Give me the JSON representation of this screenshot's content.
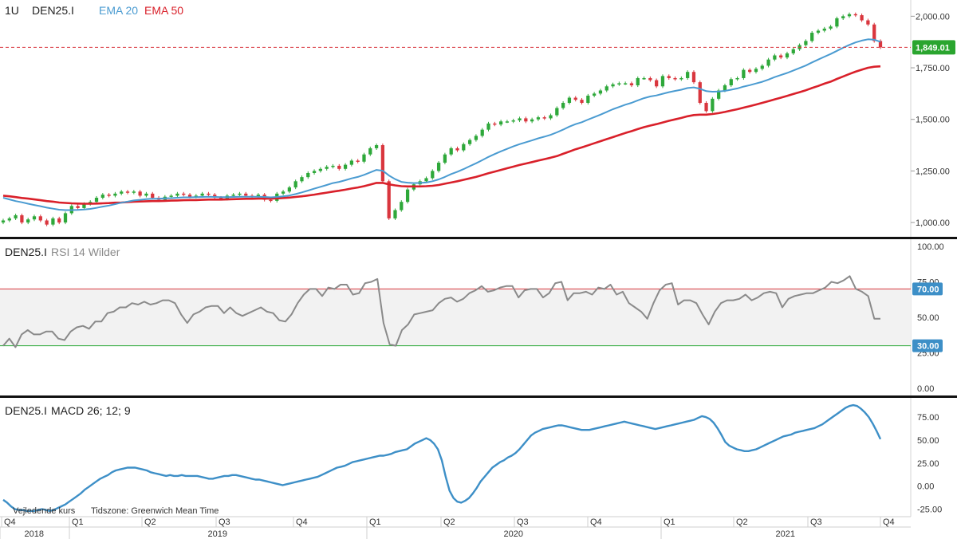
{
  "header": {
    "interval": "1U",
    "symbol": "DEN25.I",
    "ema20_label": "EMA 20",
    "ema50_label": "EMA 50"
  },
  "rsi_header": {
    "symbol": "DEN25.I",
    "label": "RSI 14 Wilder"
  },
  "macd_header": {
    "symbol": "DEN25.I",
    "label": "MACD 26; 12; 9"
  },
  "footer": {
    "note_left": "Vejledende kurs",
    "note_right": "Tidszone: Greenwich Mean Time"
  },
  "colors": {
    "up": "#2ea83a",
    "down": "#d9363e",
    "ema20": "#4a9bd1",
    "ema50": "#d9202a",
    "rsi": "#8a8a8a",
    "macd": "#3d8fc7",
    "price_badge": "#2aa52f",
    "rsi_level_badge": "#3d8fc7"
  },
  "chart_data": [
    {
      "type": "candlestick",
      "name": "price",
      "ylim": [
        950,
        2040
      ],
      "yticks": [
        "1,000.00",
        "1,250.00",
        "1,500.00",
        "1,750.00",
        "2,000.00"
      ],
      "ytick_values": [
        1000,
        1250,
        1500,
        1750,
        2000
      ],
      "last_price_label": "1,849.01",
      "last_price": 1849.01,
      "close": [
        1010,
        1020,
        1035,
        1000,
        1015,
        1030,
        1010,
        990,
        1020,
        1000,
        1045,
        1080,
        1070,
        1090,
        1100,
        1120,
        1135,
        1130,
        1140,
        1150,
        1145,
        1150,
        1130,
        1140,
        1120,
        1110,
        1125,
        1130,
        1140,
        1135,
        1125,
        1130,
        1140,
        1135,
        1120,
        1115,
        1130,
        1135,
        1140,
        1130,
        1125,
        1135,
        1110,
        1105,
        1140,
        1150,
        1170,
        1200,
        1220,
        1240,
        1250,
        1260,
        1270,
        1275,
        1260,
        1280,
        1300,
        1295,
        1330,
        1360,
        1375,
        1200,
        1020,
        1060,
        1100,
        1160,
        1185,
        1200,
        1215,
        1250,
        1290,
        1330,
        1360,
        1350,
        1380,
        1400,
        1420,
        1450,
        1480,
        1475,
        1490,
        1490,
        1495,
        1505,
        1490,
        1500,
        1510,
        1505,
        1520,
        1555,
        1580,
        1605,
        1595,
        1580,
        1615,
        1625,
        1640,
        1660,
        1670,
        1675,
        1675,
        1665,
        1700,
        1700,
        1690,
        1660,
        1710,
        1700,
        1695,
        1700,
        1730,
        1680,
        1580,
        1540,
        1600,
        1640,
        1665,
        1695,
        1700,
        1740,
        1730,
        1745,
        1760,
        1790,
        1810,
        1800,
        1820,
        1840,
        1860,
        1880,
        1920,
        1930,
        1940,
        1950,
        1990,
        2000,
        2010,
        2005,
        1980,
        1960,
        1880,
        1849.01
      ],
      "ema20": [
        1120,
        1112,
        1104,
        1098,
        1091,
        1085,
        1079,
        1072,
        1067,
        1062,
        1060,
        1060,
        1061,
        1063,
        1066,
        1071,
        1077,
        1082,
        1089,
        1096,
        1101,
        1107,
        1110,
        1113,
        1115,
        1115,
        1117,
        1118,
        1120,
        1122,
        1122,
        1123,
        1124,
        1125,
        1124,
        1123,
        1123,
        1124,
        1125,
        1125,
        1125,
        1125,
        1124,
        1122,
        1124,
        1127,
        1131,
        1138,
        1146,
        1155,
        1164,
        1173,
        1182,
        1191,
        1197,
        1205,
        1214,
        1221,
        1231,
        1243,
        1255,
        1251,
        1228,
        1210,
        1197,
        1193,
        1191,
        1192,
        1194,
        1200,
        1209,
        1221,
        1235,
        1246,
        1259,
        1273,
        1287,
        1302,
        1318,
        1332,
        1345,
        1357,
        1369,
        1380,
        1389,
        1398,
        1408,
        1416,
        1425,
        1437,
        1450,
        1465,
        1477,
        1486,
        1499,
        1511,
        1523,
        1536,
        1549,
        1560,
        1571,
        1580,
        1592,
        1603,
        1611,
        1616,
        1624,
        1632,
        1638,
        1644,
        1652,
        1655,
        1648,
        1637,
        1634,
        1635,
        1638,
        1644,
        1650,
        1659,
        1666,
        1674,
        1682,
        1693,
        1705,
        1715,
        1725,
        1737,
        1749,
        1761,
        1776,
        1790,
        1804,
        1817,
        1832,
        1847,
        1861,
        1873,
        1882,
        1888,
        1886,
        1876
      ],
      "ema50": [
        1130,
        1127,
        1123,
        1119,
        1116,
        1112,
        1108,
        1104,
        1101,
        1097,
        1095,
        1093,
        1092,
        1091,
        1091,
        1092,
        1093,
        1094,
        1096,
        1097,
        1099,
        1101,
        1102,
        1103,
        1104,
        1104,
        1105,
        1106,
        1107,
        1108,
        1109,
        1109,
        1110,
        1111,
        1111,
        1111,
        1112,
        1113,
        1114,
        1115,
        1115,
        1116,
        1116,
        1116,
        1117,
        1119,
        1121,
        1124,
        1127,
        1131,
        1135,
        1140,
        1145,
        1150,
        1154,
        1159,
        1165,
        1170,
        1176,
        1184,
        1192,
        1192,
        1185,
        1180,
        1176,
        1175,
        1175,
        1175,
        1176,
        1178,
        1182,
        1188,
        1194,
        1200,
        1207,
        1214,
        1221,
        1230,
        1239,
        1247,
        1255,
        1263,
        1271,
        1279,
        1286,
        1293,
        1300,
        1307,
        1314,
        1322,
        1333,
        1344,
        1355,
        1364,
        1374,
        1384,
        1394,
        1404,
        1414,
        1424,
        1434,
        1443,
        1453,
        1462,
        1470,
        1477,
        1485,
        1493,
        1500,
        1507,
        1515,
        1521,
        1523,
        1523,
        1526,
        1530,
        1536,
        1543,
        1549,
        1557,
        1564,
        1572,
        1580,
        1588,
        1597,
        1605,
        1614,
        1623,
        1632,
        1641,
        1652,
        1662,
        1673,
        1683,
        1696,
        1708,
        1720,
        1731,
        1741,
        1750,
        1755,
        1757
      ]
    },
    {
      "type": "line",
      "name": "rsi",
      "ylim": [
        -5,
        105
      ],
      "yticks": [
        "0.00",
        "25.00",
        "50.00",
        "75.00",
        "100.00"
      ],
      "ytick_values": [
        0,
        25,
        50,
        75,
        100
      ],
      "upper_level": 70,
      "lower_level": 30,
      "upper_label": "70.00",
      "lower_label": "30.00",
      "values": [
        30,
        35,
        29,
        38,
        41,
        38,
        38,
        40,
        40,
        35,
        34,
        40,
        43,
        44,
        42,
        47,
        47,
        53,
        54,
        57,
        57,
        60,
        59,
        61,
        59,
        60,
        62,
        62,
        60,
        52,
        46,
        52,
        54,
        57,
        58,
        58,
        53,
        57,
        53,
        51,
        53,
        55,
        57,
        54,
        53,
        48,
        47,
        52,
        60,
        66,
        70,
        70,
        65,
        71,
        70,
        73,
        73,
        66,
        67,
        74,
        75,
        77,
        46,
        31,
        30,
        41,
        45,
        52,
        53,
        54,
        55,
        60,
        63,
        64,
        61,
        63,
        67,
        69,
        72,
        68,
        69,
        71,
        72,
        72,
        64,
        69,
        70,
        70,
        64,
        67,
        74,
        75,
        62,
        67,
        67,
        68,
        66,
        71,
        70,
        73,
        66,
        68,
        60,
        57,
        54,
        49,
        60,
        69,
        73,
        74,
        59,
        62,
        62,
        60,
        52,
        45,
        54,
        60,
        62,
        62,
        63,
        66,
        62,
        64,
        67,
        68,
        67,
        57,
        63,
        65,
        66,
        67,
        67,
        69,
        71,
        75,
        74,
        76,
        79,
        70,
        68,
        65,
        49,
        49
      ]
    },
    {
      "type": "line",
      "name": "macd",
      "ylim": [
        -35,
        95
      ],
      "yticks": [
        "-25.00",
        "0.00",
        "25.00",
        "50.00",
        "75.00"
      ],
      "ytick_values": [
        -25,
        0,
        25,
        50,
        75
      ],
      "values": [
        -15,
        -18,
        -22,
        -25,
        -26,
        -26,
        -27,
        -27,
        -27,
        -26,
        -25,
        -26,
        -27,
        -26,
        -24,
        -22,
        -20,
        -17,
        -14,
        -11,
        -8,
        -4,
        -1,
        2,
        5,
        8,
        10,
        12,
        15,
        17,
        18,
        19,
        20,
        20,
        20,
        19,
        18,
        17,
        15,
        14,
        13,
        12,
        11,
        12,
        11,
        11,
        12,
        11,
        11,
        11,
        11,
        10,
        9,
        8,
        8,
        9,
        10,
        11,
        11,
        12,
        12,
        11,
        10,
        9,
        8,
        7,
        7,
        6,
        5,
        4,
        3,
        2,
        1,
        2,
        3,
        4,
        5,
        6,
        7,
        8,
        9,
        10,
        12,
        14,
        16,
        18,
        20,
        21,
        22,
        24,
        26,
        27,
        28,
        29,
        30,
        31,
        32,
        33,
        33,
        34,
        35,
        37,
        38,
        39,
        40,
        43,
        46,
        48,
        50,
        52,
        50,
        46,
        40,
        28,
        10,
        -5,
        -13,
        -17,
        -18,
        -16,
        -13,
        -8,
        -2,
        5,
        10,
        15,
        20,
        23,
        26,
        28,
        31,
        33,
        36,
        40,
        45,
        50,
        55,
        58,
        60,
        62,
        63,
        64,
        65,
        66,
        66,
        65,
        64,
        63,
        62,
        61,
        61,
        61,
        62,
        63,
        64,
        65,
        66,
        67,
        68,
        69,
        70,
        69,
        68,
        67,
        66,
        65,
        64,
        63,
        62,
        63,
        64,
        65,
        66,
        67,
        68,
        69,
        70,
        71,
        72,
        74,
        76,
        75,
        73,
        69,
        63,
        56,
        48,
        44,
        42,
        40,
        39,
        38,
        38,
        39,
        40,
        42,
        44,
        46,
        48,
        50,
        52,
        54,
        55,
        56,
        58,
        59,
        60,
        61,
        62,
        63,
        65,
        67,
        70,
        73,
        76,
        79,
        82,
        85,
        87,
        88,
        87,
        84,
        80,
        75,
        68,
        60,
        51
      ]
    }
  ],
  "time_axis": {
    "quarters": [
      "Q4",
      "Q1",
      "Q2",
      "Q3",
      "Q4",
      "Q1",
      "Q2",
      "Q3",
      "Q4",
      "Q1",
      "Q2",
      "Q3",
      "Q4"
    ],
    "years": [
      "2018",
      "2019",
      "2020",
      "2021"
    ]
  }
}
